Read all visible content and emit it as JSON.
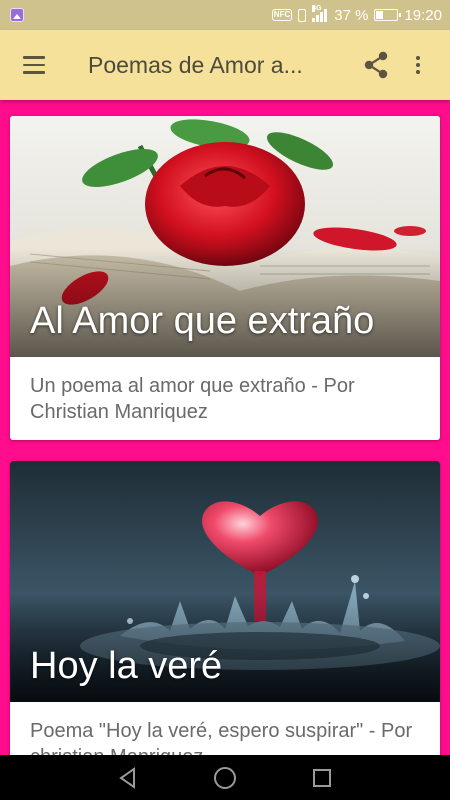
{
  "status_bar": {
    "battery_percent": "37 %",
    "time": "19:20",
    "network_label": "4G",
    "nfc_label": "NFC",
    "icons": [
      "gallery-icon",
      "nfc-icon",
      "vibrate-icon",
      "signal-icon",
      "battery-icon"
    ]
  },
  "app_bar": {
    "title": "Poemas de Amor a...",
    "icons": [
      "menu-icon",
      "share-icon",
      "more-vert-icon"
    ],
    "background": "#f5e19a"
  },
  "page": {
    "background": "#ff0d8c"
  },
  "cards": [
    {
      "title": "Al Amor que extraño",
      "description": "Un poema al amor que extraño - Por Christian Manriquez",
      "image": "rose-on-book-image"
    },
    {
      "title": "Hoy la veré",
      "description": "Poema  \"Hoy la veré, espero suspirar\" - Por christian Manriquez",
      "image": "water-heart-image"
    }
  ],
  "nav_bar": {
    "icons": [
      "back-icon",
      "home-icon",
      "recents-icon"
    ]
  }
}
